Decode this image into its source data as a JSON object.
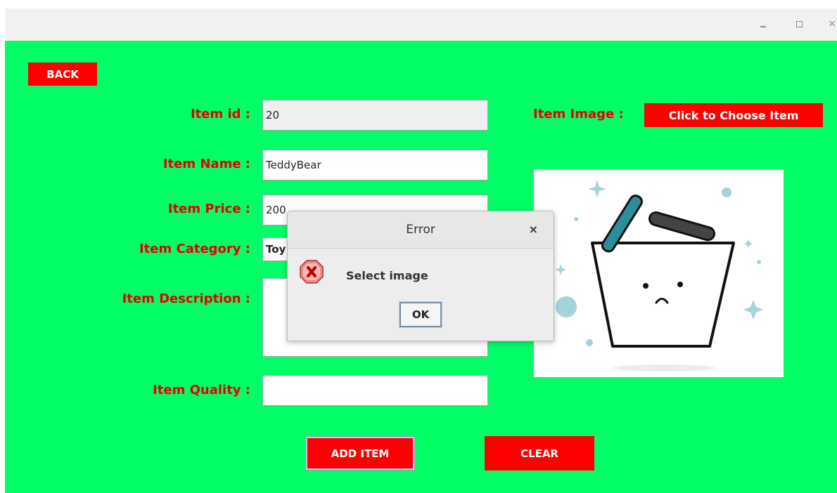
{
  "window": {
    "minimize_icon": "minimize-icon",
    "maximize_icon": "maximize-icon",
    "close_glyph": "×"
  },
  "colors": {
    "panel_bg": "#00ff66",
    "button_bg": "#ff0000",
    "label_color": "#e60000"
  },
  "back_label": "BACK",
  "form": {
    "id_label": "Item id :",
    "id_value": "20",
    "name_label": "Item Name :",
    "name_value": "TeddyBear",
    "price_label": "Item Price :",
    "price_value": "200",
    "category_label": "Item Category :",
    "category_value": "Toy",
    "description_label": "Item Description :",
    "description_value": "",
    "quality_label": "Item Quality :",
    "quality_value": "",
    "image_label": "Item Image :",
    "choose_label": "Click to Choose Item"
  },
  "actions": {
    "add_label": "ADD ITEM",
    "clear_label": "CLEAR"
  },
  "dialog": {
    "title": "Error",
    "close_glyph": "×",
    "icon": "error-icon",
    "message": "Select image",
    "ok_label": "OK"
  }
}
